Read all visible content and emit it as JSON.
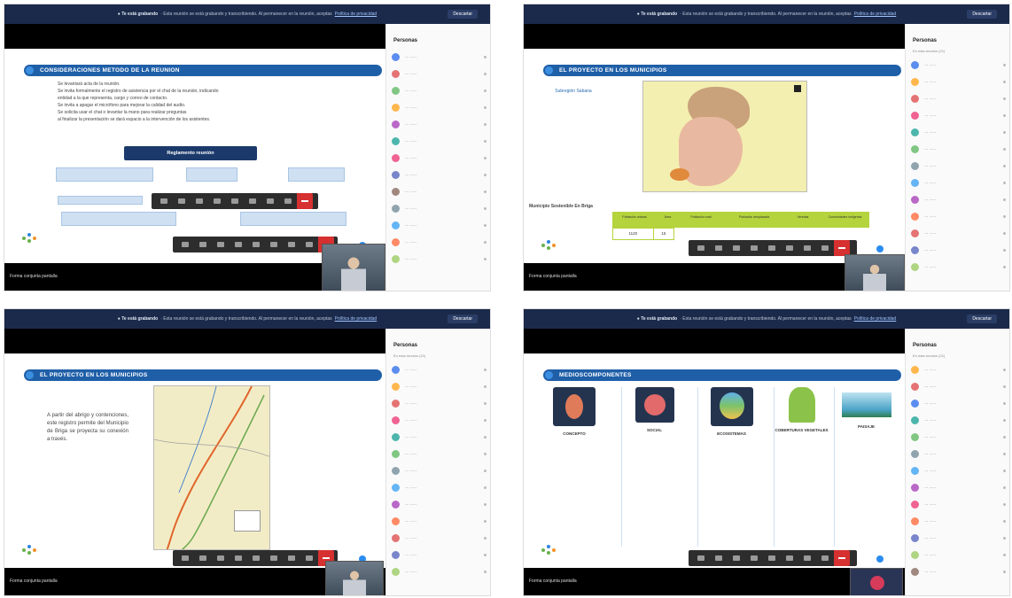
{
  "topbar": {
    "notice": "● Te está grabando",
    "notice_text": "· Esta reunión se está grabando y transcribiendo. Al permanecer en la reunión, aceptas",
    "notice_link": "Política de privacidad",
    "dismiss": "Descartar"
  },
  "sidebar": {
    "title": "Personas",
    "subtitle": "En esta reunión (21)"
  },
  "bottom": {
    "label": "Forma conjunta pantalla"
  },
  "slides": [
    {
      "title": "CONSIDERACIONES METODO DE LA REUNION",
      "bullets": [
        "Se levantará acta de la reunión.",
        "Se invita formalmente el registro de asistencia por el chat de la reunión, indicando",
        "entidad a la que representa, cargo y correo de contacto.",
        "Se invita a apagar el micrófono para mejorar la calidad del audio.",
        "Se solicita usar el chat o levantar la mano para realizar preguntas",
        "al finalizar la presentación se dará espacio a la intervención de los asistentes."
      ],
      "pill": "Reglamento reunión"
    },
    {
      "title": "EL PROYECTO EN LOS MUNICIPIOS",
      "map_label": "Subregión Sabana",
      "table_caption": "Municipio Sostenible En Briga",
      "table_headers": [
        "Población urbana",
        "Área",
        "Población rural",
        "Población desplazada",
        "Veredas",
        "Comunidades indígenas"
      ],
      "table_values": [
        "1120",
        "15",
        "",
        "",
        "",
        ""
      ]
    },
    {
      "title": "EL PROYECTO EN LOS MUNICIPIOS",
      "body": "A partir del abrigo y contenciones, este registro permite del Municipio de Briga se proyecta su conexión a través."
    },
    {
      "title": "MEDIOSCOMPONENTES",
      "columns": [
        "CONCEPTO",
        "SOCIAL",
        "ECOSISTEMAS",
        "COBERTURAS VEGETALES",
        "PAISAJE"
      ]
    }
  ]
}
